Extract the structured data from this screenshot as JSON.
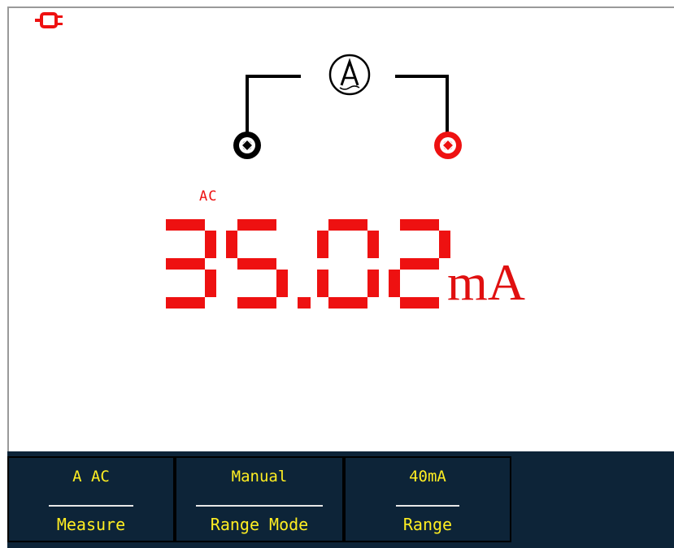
{
  "meter": {
    "coupling": "AC",
    "reading": "35.02",
    "unit": "mA",
    "probe_icon": "ammeter-clamp-icon",
    "status_icon": "power-plug-icon"
  },
  "softkeys": [
    {
      "value": "A AC",
      "label": "Measure"
    },
    {
      "value": "Manual",
      "label": "Range Mode"
    },
    {
      "value": "40mA",
      "label": "Range"
    }
  ],
  "colors": {
    "accent": "#ee1111",
    "softkey_bg": "#0d2438",
    "softkey_text": "#ffee22",
    "probe_common": "#000000",
    "probe_hot": "#ee1111"
  }
}
